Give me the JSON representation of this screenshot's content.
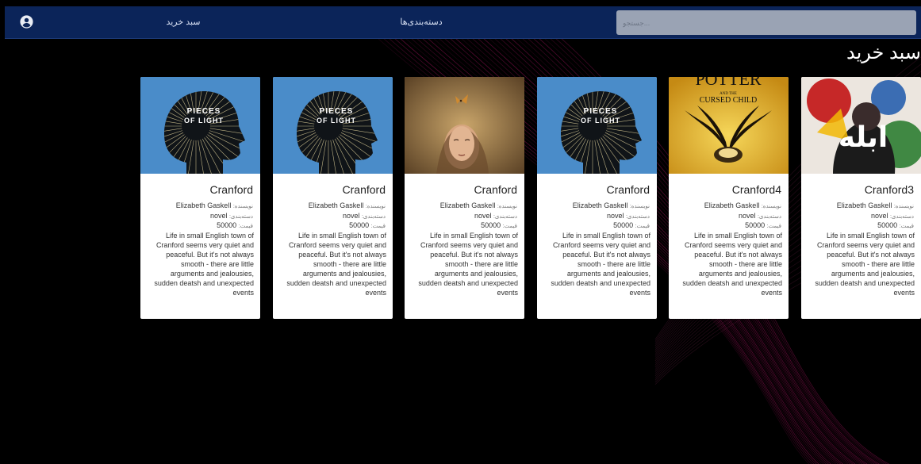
{
  "header": {
    "cart_link": "سبد خرید",
    "categories_link": "دسته‌بندی‌ها",
    "search_placeholder": "جستجو..."
  },
  "page_title": "سبد خرید",
  "labels": {
    "author": "نویسنده:",
    "category": "دسته‌بندی:",
    "price": "قیمت:"
  },
  "cards": [
    {
      "cover": "pieces-of-light",
      "cover_text": [
        "PIECES",
        "OF LIGHT"
      ],
      "title": "Cranford",
      "author": "Elizabeth Gaskell",
      "category": "novel",
      "price": "50000",
      "description": "Life in small English town of Cranford seems very quiet and peaceful. But it's not always smooth - there are little arguments and jealousies, sudden deatsh and unexpected events"
    },
    {
      "cover": "pieces-of-light",
      "cover_text": [
        "PIECES",
        "OF LIGHT"
      ],
      "title": "Cranford",
      "author": "Elizabeth Gaskell",
      "category": "novel",
      "price": "50000",
      "description": "Life in small English town of Cranford seems very quiet and peaceful. But it's not always smooth - there are little arguments and jealousies, sudden deatsh and unexpected events"
    },
    {
      "cover": "woman-butterfly",
      "cover_text": [],
      "title": "Cranford",
      "author": "Elizabeth Gaskell",
      "category": "novel",
      "price": "50000",
      "description": "Life in small English town of Cranford seems very quiet and peaceful. But it's not always smooth - there are little arguments and jealousies, sudden deatsh and unexpected events"
    },
    {
      "cover": "pieces-of-light",
      "cover_text": [
        "PIECES",
        "OF LIGHT"
      ],
      "title": "Cranford",
      "author": "Elizabeth Gaskell",
      "category": "novel",
      "price": "50000",
      "description": "Life in small English town of Cranford seems very quiet and peaceful. But it's not always smooth - there are little arguments and jealousies, sudden deatsh and unexpected events"
    },
    {
      "cover": "cursed-child",
      "cover_text": [
        "POTTER",
        "AND THE",
        "CURSED CHILD"
      ],
      "title": "Cranford4",
      "author": "Elizabeth Gaskell",
      "category": "novel",
      "price": "50000",
      "description": "Life in small English town of Cranford seems very quiet and peaceful. But it's not always smooth - there are little arguments and jealousies, sudden deatsh and unexpected events"
    },
    {
      "cover": "ablah",
      "cover_text": [
        "ابله"
      ],
      "title": "Cranford3",
      "author": "Elizabeth Gaskell",
      "category": "novel",
      "price": "50000",
      "description": "Life in small English town of Cranford seems very quiet and peaceful. But it's not always smooth - there are little arguments and jealousies, sudden deatsh and unexpected events"
    }
  ],
  "colors": {
    "header_bg": "#0b2459",
    "search_bg": "#9aa3b4",
    "page_bg": "#000000",
    "swirl": "#c2186f",
    "card_bg": "#ffffff",
    "cover_blue": "#4a8cc9"
  }
}
